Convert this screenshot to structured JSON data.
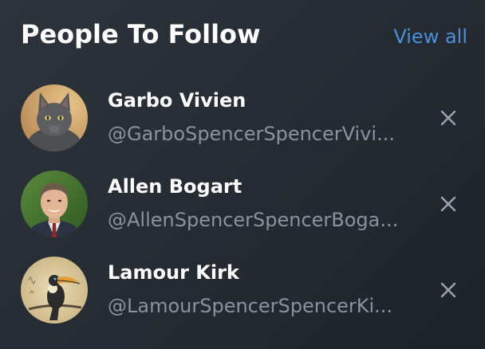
{
  "header": {
    "title": "People To Follow",
    "view_all_label": "View all"
  },
  "people": [
    {
      "name": "Garbo Vivien",
      "handle": "@GarboSpencerSpencerVivi...",
      "avatar_icon": "cat-avatar"
    },
    {
      "name": "Allen Bogart",
      "handle": "@AllenSpencerSpencerBoga...",
      "avatar_icon": "man-avatar"
    },
    {
      "name": "Lamour Kirk",
      "handle": "@LamourSpencerSpencerKi...",
      "avatar_icon": "toucan-avatar"
    }
  ],
  "dismiss_icon": "close-icon",
  "colors": {
    "background": "#272d34",
    "title": "#ffffff",
    "link": "#4a90d9",
    "handle": "#8a929b",
    "dismiss": "#9aa3ac"
  }
}
